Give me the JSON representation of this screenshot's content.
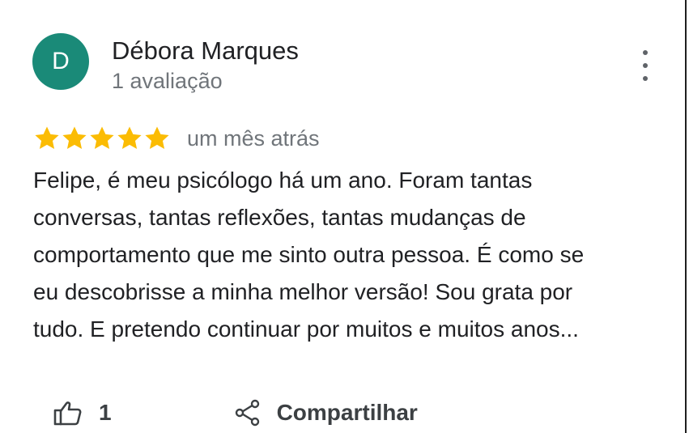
{
  "review": {
    "author": {
      "initial": "D",
      "name": "Débora Marques",
      "review_count": "1 avaliação",
      "avatar_color": "#1a8a78"
    },
    "rating": 5,
    "star_color": "#fbbc04",
    "timestamp": "um mês atrás",
    "text_lines": [
      "Felipe, é meu psicólogo há um ano. Foram tantas",
      "conversas, tantas reflexões, tantas mudanças de",
      "comportamento que me sinto outra pessoa. É como se",
      "eu descobrisse a minha melhor versão! Sou grata por",
      "tudo. E pretendo continuar por muitos e muitos anos..."
    ],
    "actions": {
      "like_icon": "thumbs-up-icon",
      "like_count": "1",
      "share_icon": "share-icon",
      "share_label": "Compartilhar"
    },
    "menu_icon": "more-vert-icon"
  }
}
